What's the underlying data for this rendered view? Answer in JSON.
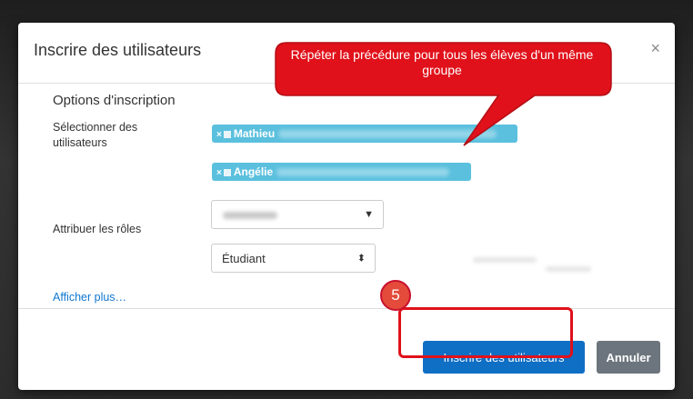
{
  "modal": {
    "title": "Inscrire des utilisateurs",
    "close_icon": "×"
  },
  "callout": {
    "text": "Répéter la précédure pour tous les élèves d'un même groupe"
  },
  "form": {
    "section_title": "Options d'inscription",
    "select_users_label": "Sélectionner des utilisateurs",
    "selected_users": [
      {
        "remove": "×",
        "name": "Mathieu"
      },
      {
        "remove": "×",
        "name": "Angélie"
      }
    ],
    "dropdown_arrow": "▼",
    "assign_roles_label": "Attribuer les rôles",
    "role_value": "Étudiant",
    "role_arrow": "⬍",
    "show_more_link": "Afficher plus…"
  },
  "tutorial": {
    "step_number": "5"
  },
  "footer": {
    "submit_label": "Inscrire des utilisateurs",
    "cancel_label": "Annuler"
  },
  "colors": {
    "primary": "#0f6fc5",
    "chip": "#5bc0de",
    "callout": "#e0111a",
    "secondary": "#6c757d"
  },
  "icons": [
    "close-icon",
    "remove-icon",
    "user-icon",
    "chevron-down-icon",
    "updown-icon"
  ]
}
